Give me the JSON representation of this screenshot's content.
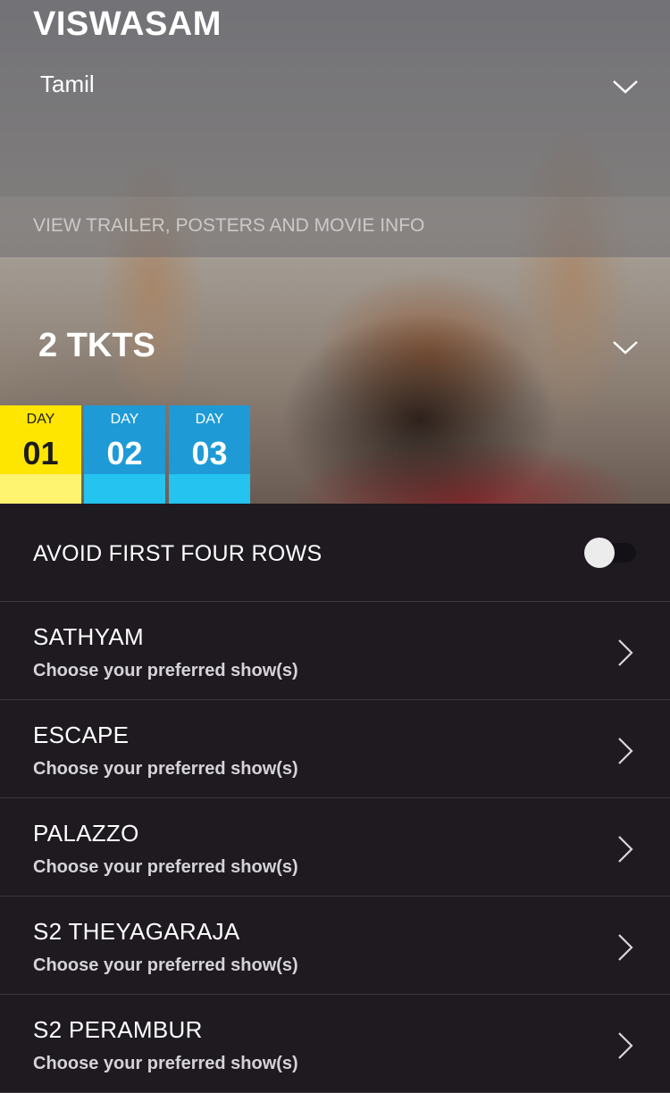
{
  "movie": {
    "title": "VISWASAM",
    "language": "Tamil",
    "info_link": "VIEW TRAILER, POSTERS AND MOVIE INFO",
    "tickets": "2 TKTS"
  },
  "days": [
    {
      "label": "DAY",
      "number": "01",
      "selected": true
    },
    {
      "label": "DAY",
      "number": "02",
      "selected": false
    },
    {
      "label": "DAY",
      "number": "03",
      "selected": false
    }
  ],
  "colors": {
    "selected_day": "#ffe600",
    "day": "#1e9bd6",
    "background": "#1e1a20"
  },
  "avoid_rows": {
    "label": "AVOID FIRST FOUR ROWS",
    "enabled": false
  },
  "theatres": [
    {
      "name": "SATHYAM",
      "subtitle": "Choose your preferred show(s)"
    },
    {
      "name": "ESCAPE",
      "subtitle": "Choose your preferred show(s)"
    },
    {
      "name": "PALAZZO",
      "subtitle": "Choose your preferred show(s)"
    },
    {
      "name": "S2 THEYAGARAJA",
      "subtitle": "Choose your preferred show(s)"
    },
    {
      "name": "S2 PERAMBUR",
      "subtitle": "Choose your preferred show(s)"
    }
  ]
}
